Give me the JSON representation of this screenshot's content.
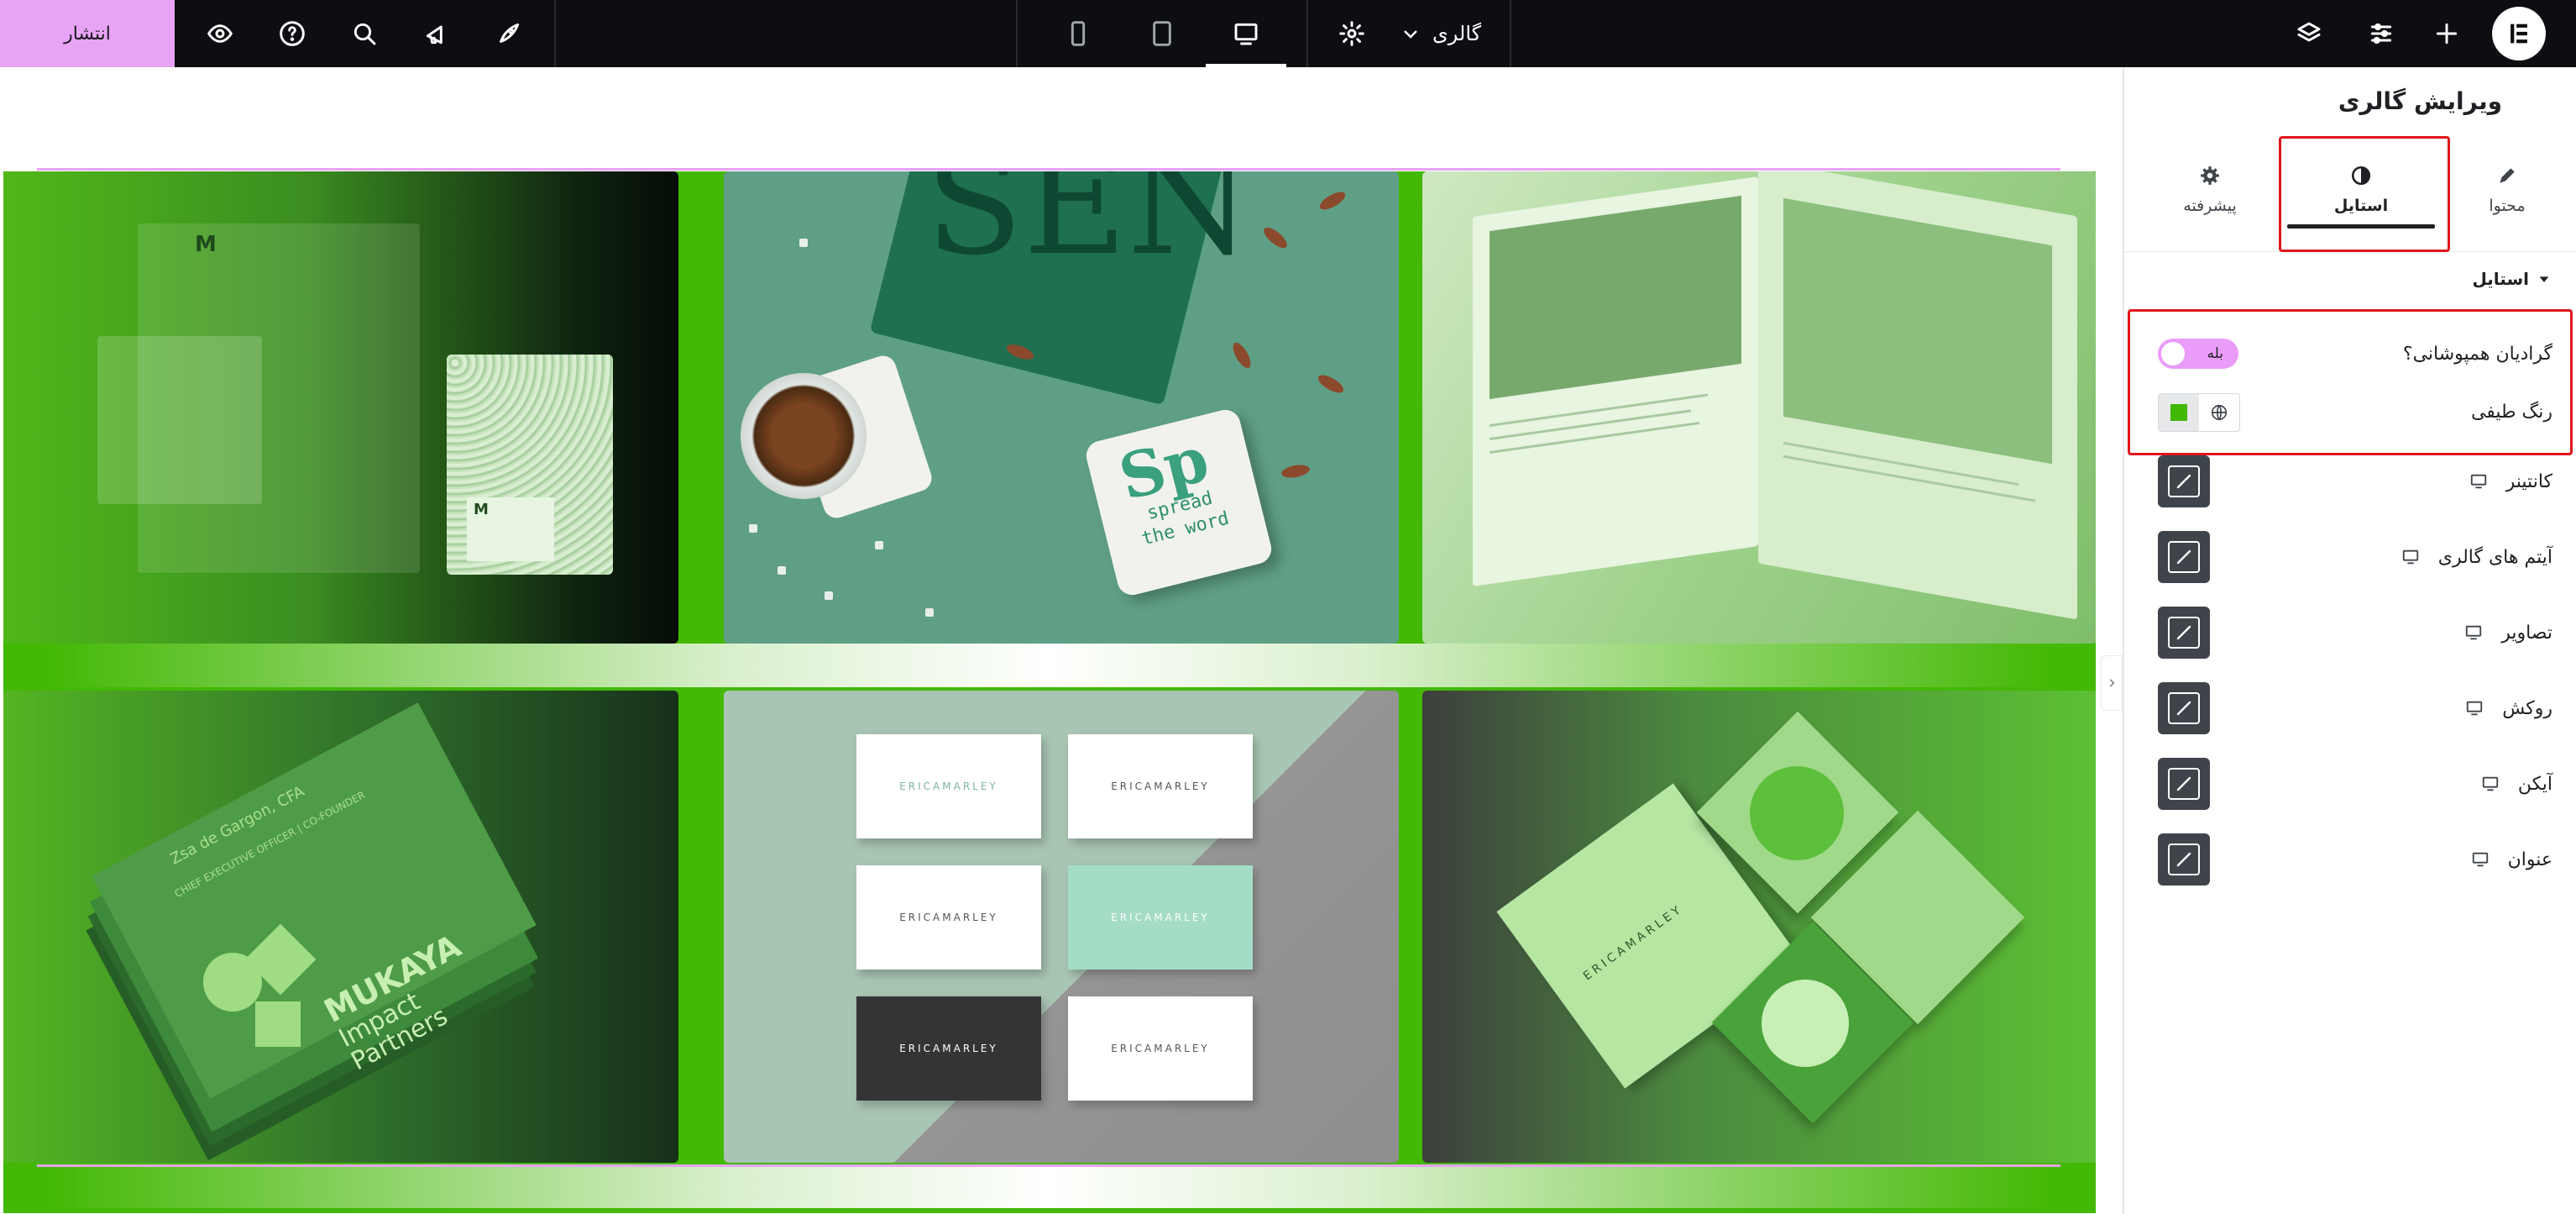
{
  "topbar": {
    "publish_label": "انتشار",
    "document_title": "گالری",
    "icons": [
      "eye-icon",
      "help-icon",
      "search-icon",
      "announcement-icon",
      "rocket-icon",
      "settings-icon",
      "chevron-down-icon",
      "structure-icon",
      "sliders-icon",
      "plus-icon",
      "elementor-logo"
    ],
    "devices": [
      "mobile-portrait",
      "tablet",
      "desktop"
    ],
    "active_device": "desktop"
  },
  "panel": {
    "title": "ویرایش گالری",
    "tabs": [
      {
        "label": "پیشرفته",
        "icon": "gear-icon"
      },
      {
        "label": "استایل",
        "icon": "half-circle-icon"
      },
      {
        "label": "محتوا",
        "icon": "pencil-icon"
      }
    ],
    "active_tab": "استایل",
    "section_title": "استایل",
    "overlay_gradient": {
      "label": "گرادیان همپوشانی؟",
      "value": "بله"
    },
    "spectrum_color": {
      "label": "رنگ طیفی",
      "color": "#43b805"
    },
    "controls": [
      {
        "label": "کانتینر"
      },
      {
        "label": "آیتم های گالری"
      },
      {
        "label": "تصاویر"
      },
      {
        "label": "روکش"
      },
      {
        "label": "آیکن"
      },
      {
        "label": "عنوان"
      }
    ]
  },
  "gallery": {
    "tile2": {
      "coaster_line1": "spread",
      "coaster_line2": "the word",
      "coaster_big": "Sp"
    },
    "tile4": {
      "brand_line1": "MUKAYA",
      "brand_line2": "Impact",
      "brand_line3": "Partners",
      "card_line1": "Zsa de Gargon, CFA",
      "card_line2": "CHIEF EXECUTIVE OFFICER | CO-FOUNDER"
    },
    "tile5": {
      "card_brand": "ERICAMARLEY"
    },
    "tile6": {
      "card_brand": "ERICAMARLEY"
    }
  },
  "colors": {
    "accent": "#e7a3f5",
    "overlay": "#43b805",
    "topbar": "#0d0e12",
    "highlight": "#e0151c"
  }
}
